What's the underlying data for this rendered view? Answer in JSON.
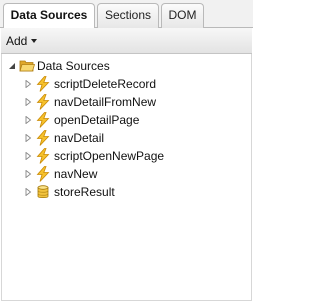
{
  "tabs": [
    {
      "label": "Data Sources",
      "active": true
    },
    {
      "label": "Sections",
      "active": false
    },
    {
      "label": "DOM",
      "active": false
    }
  ],
  "toolbar": {
    "add_label": "Add"
  },
  "tree": {
    "root": {
      "label": "Data Sources",
      "icon": "folder-open-icon",
      "expanded": true
    },
    "children": [
      {
        "label": "scriptDeleteRecord",
        "icon": "lightning-icon"
      },
      {
        "label": "navDetailFromNew",
        "icon": "lightning-icon"
      },
      {
        "label": "openDetailPage",
        "icon": "lightning-icon"
      },
      {
        "label": "navDetail",
        "icon": "lightning-icon"
      },
      {
        "label": "scriptOpenNewPage",
        "icon": "lightning-icon"
      },
      {
        "label": "navNew",
        "icon": "lightning-icon"
      },
      {
        "label": "storeResult",
        "icon": "database-icon"
      }
    ]
  },
  "colors": {
    "folder": "#f3c94b",
    "lightning": "#f2b51f",
    "database": "#e8b830",
    "border": "#b9b9b9"
  }
}
